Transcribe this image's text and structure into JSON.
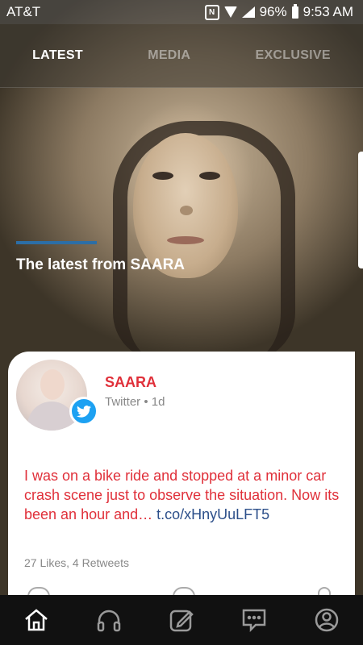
{
  "status_bar": {
    "carrier": "AT&T",
    "nfc": "N",
    "battery": "96%",
    "time": "9:53 AM"
  },
  "tabs": [
    {
      "label": "LATEST",
      "active": true
    },
    {
      "label": "MEDIA",
      "active": false
    },
    {
      "label": "EXCLUSIVE",
      "active": false
    }
  ],
  "hero": {
    "title": "The latest from SAARA",
    "accent_color": "#2c6ea6"
  },
  "post": {
    "author": "SAARA",
    "source": "Twitter",
    "age": "1d",
    "meta": "Twitter • 1d",
    "text": "I was on a bike ride and stopped at a minor car crash scene just to observe the situation. Now its been an hour and… ",
    "link": "t.co/xHnyUuLFT5",
    "stats": "27 Likes, 4 Retweets",
    "author_color": "#e0303a",
    "badge_icon": "twitter-icon"
  },
  "bottom_nav": [
    {
      "name": "home-icon",
      "active": true
    },
    {
      "name": "headphones-icon",
      "active": false
    },
    {
      "name": "compose-icon",
      "active": false
    },
    {
      "name": "chat-icon",
      "active": false
    },
    {
      "name": "profile-icon",
      "active": false
    }
  ]
}
